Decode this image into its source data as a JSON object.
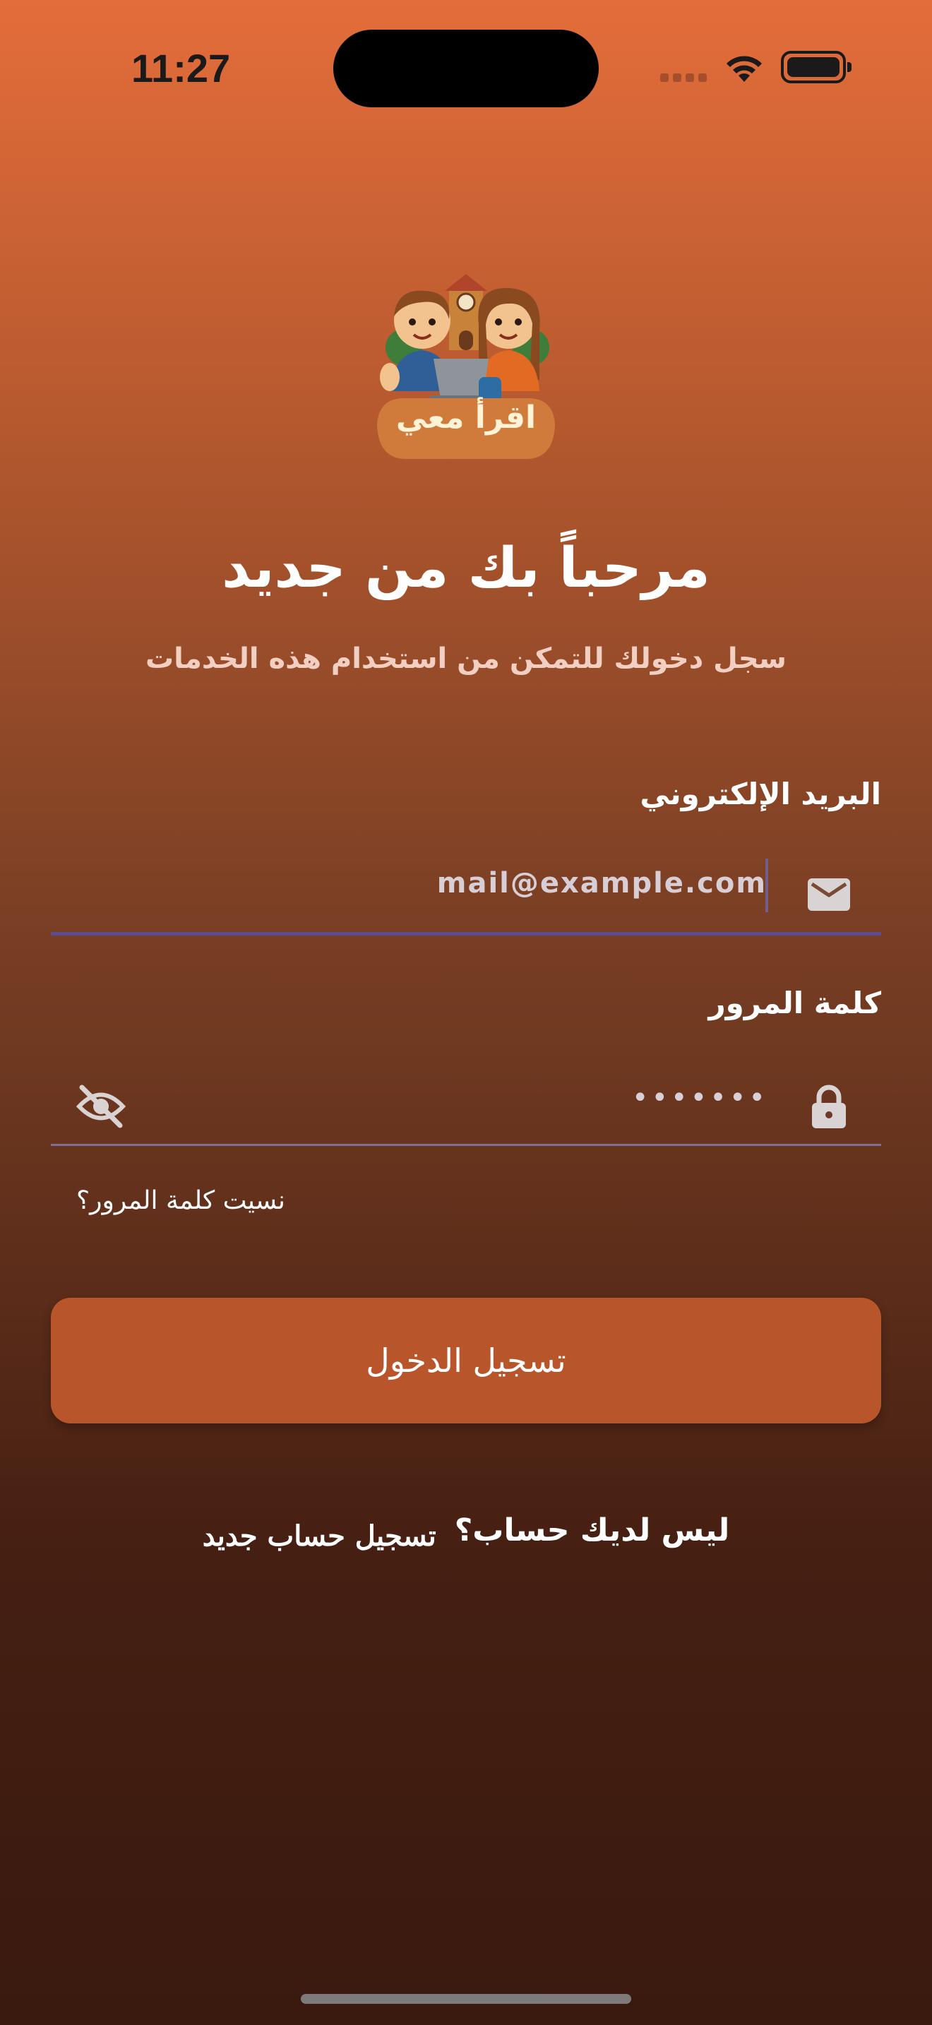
{
  "status_bar": {
    "time": "11:27",
    "icons": [
      "signal-icon",
      "wifi-icon",
      "battery-icon"
    ]
  },
  "logo": {
    "text": "اقرأ معي"
  },
  "header": {
    "title": "مرحباً بك من جديد",
    "subtitle": "سجل دخولك للتمكن من استخدام هذه الخدمات"
  },
  "form": {
    "email_label": "البريد الإلكتروني",
    "email_placeholder": "mail@example.com",
    "email_icon": "mail-icon",
    "password_label": "كلمة المرور",
    "password_value": "•••••••",
    "password_icon": "lock-icon",
    "visibility_icon": "eye-off-icon",
    "forgot_password": "نسيت كلمة المرور؟",
    "login_button": "تسجيل الدخول"
  },
  "signup": {
    "prompt": "ليس لديك حساب؟",
    "link": "تسجيل حساب جديد"
  },
  "colors": {
    "accent": "#b9552b",
    "field_underline": "#5a4e8e"
  }
}
